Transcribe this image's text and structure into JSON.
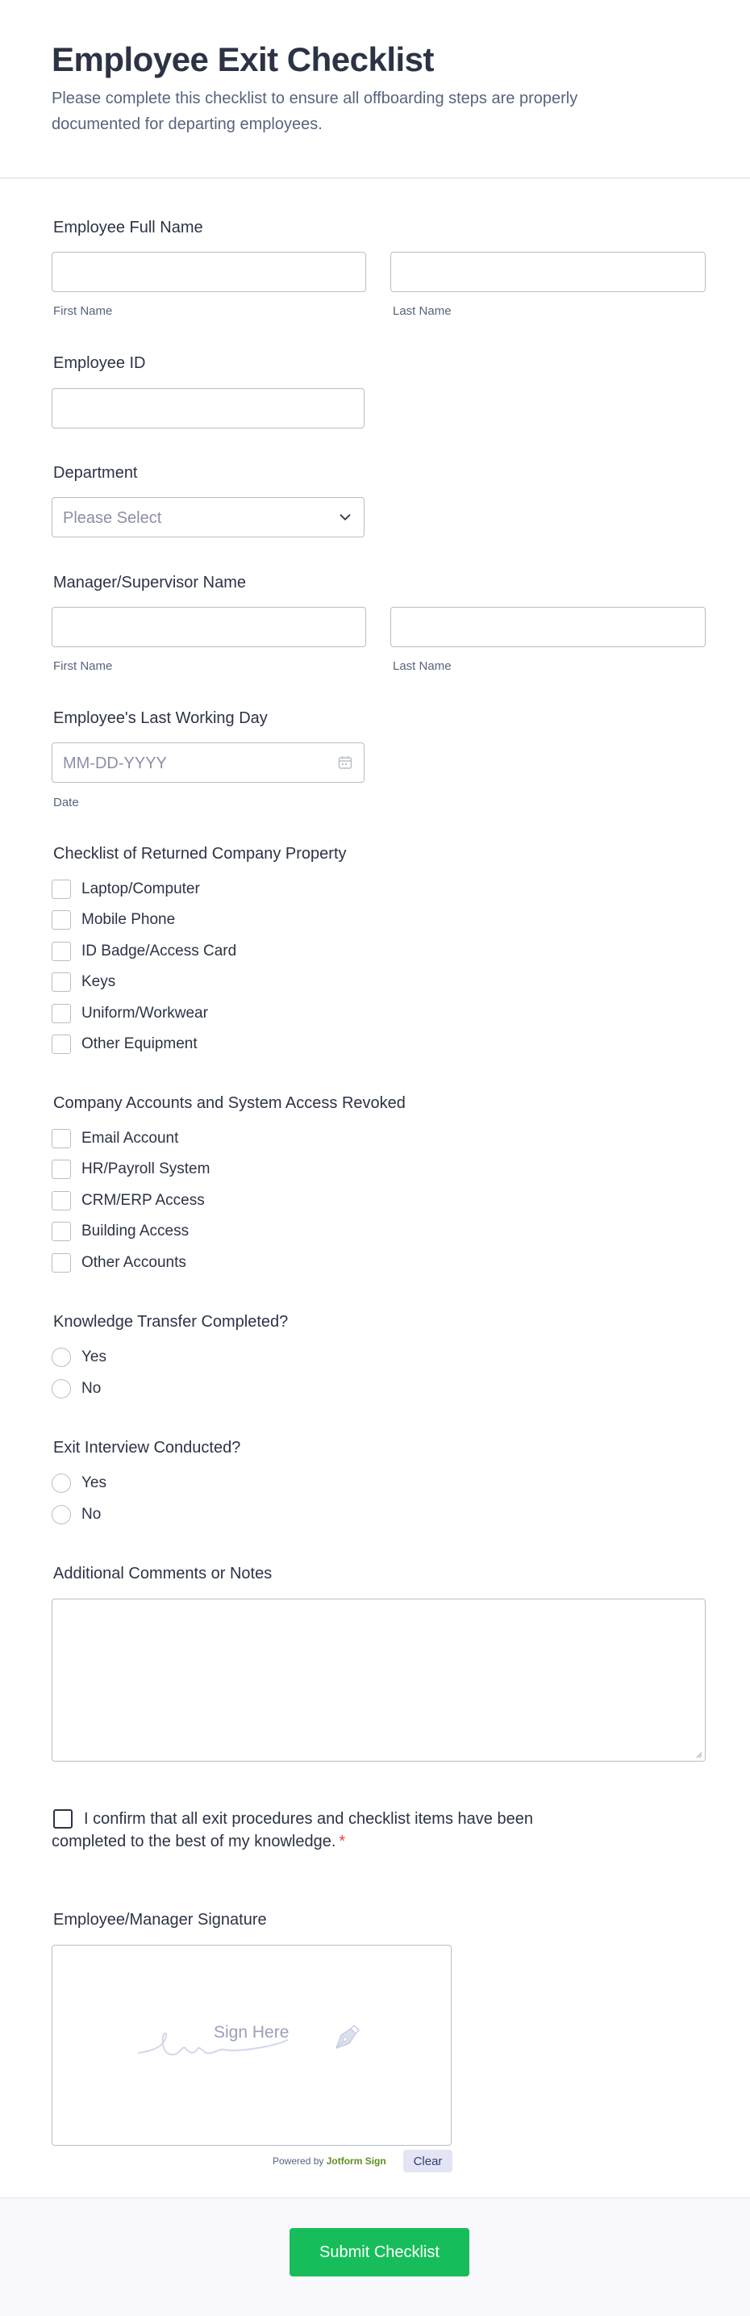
{
  "form": {
    "title": "Employee Exit Checklist",
    "subtitle": "Please complete this checklist to ensure all offboarding steps are properly documented for departing employees."
  },
  "employee_name": {
    "label": "Employee Full Name",
    "first_sublabel": "First Name",
    "last_sublabel": "Last Name",
    "first_value": "",
    "last_value": ""
  },
  "employee_id": {
    "label": "Employee ID",
    "value": ""
  },
  "department": {
    "label": "Department",
    "placeholder": "Please Select"
  },
  "manager_name": {
    "label": "Manager/Supervisor Name",
    "first_sublabel": "First Name",
    "last_sublabel": "Last Name",
    "first_value": "",
    "last_value": ""
  },
  "last_day": {
    "label": "Employee's Last Working Day",
    "placeholder": "MM-DD-YYYY",
    "sublabel": "Date"
  },
  "property": {
    "label": "Checklist of Returned Company Property",
    "options": [
      "Laptop/Computer",
      "Mobile Phone",
      "ID Badge/Access Card",
      "Keys",
      "Uniform/Workwear",
      "Other Equipment"
    ]
  },
  "accounts": {
    "label": "Company Accounts and System Access Revoked",
    "options": [
      "Email Account",
      "HR/Payroll System",
      "CRM/ERP Access",
      "Building Access",
      "Other Accounts"
    ]
  },
  "knowledge": {
    "label": "Knowledge Transfer Completed?",
    "options": [
      "Yes",
      "No"
    ]
  },
  "interview": {
    "label": "Exit Interview Conducted?",
    "options": [
      "Yes",
      "No"
    ]
  },
  "comments": {
    "label": "Additional Comments or Notes",
    "value": ""
  },
  "confirm": {
    "text": "I confirm that all exit procedures and checklist items have been completed to the best of my knowledge.",
    "required_mark": "*"
  },
  "signature": {
    "label": "Employee/Manager Signature",
    "placeholder": "Sign Here",
    "powered_prefix": "Powered by",
    "powered_brand": "Jotform Sign",
    "clear_label": "Clear"
  },
  "submit": {
    "label": "Submit Checklist"
  },
  "colors": {
    "accent": "#18bd5b",
    "text": "#2c3345",
    "muted": "#57647e",
    "border": "#b8bdc9",
    "required": "#f23a3c"
  },
  "icons": {
    "select": "chevron-down-icon",
    "date": "calendar-icon",
    "signature": "pen-nib-icon"
  }
}
